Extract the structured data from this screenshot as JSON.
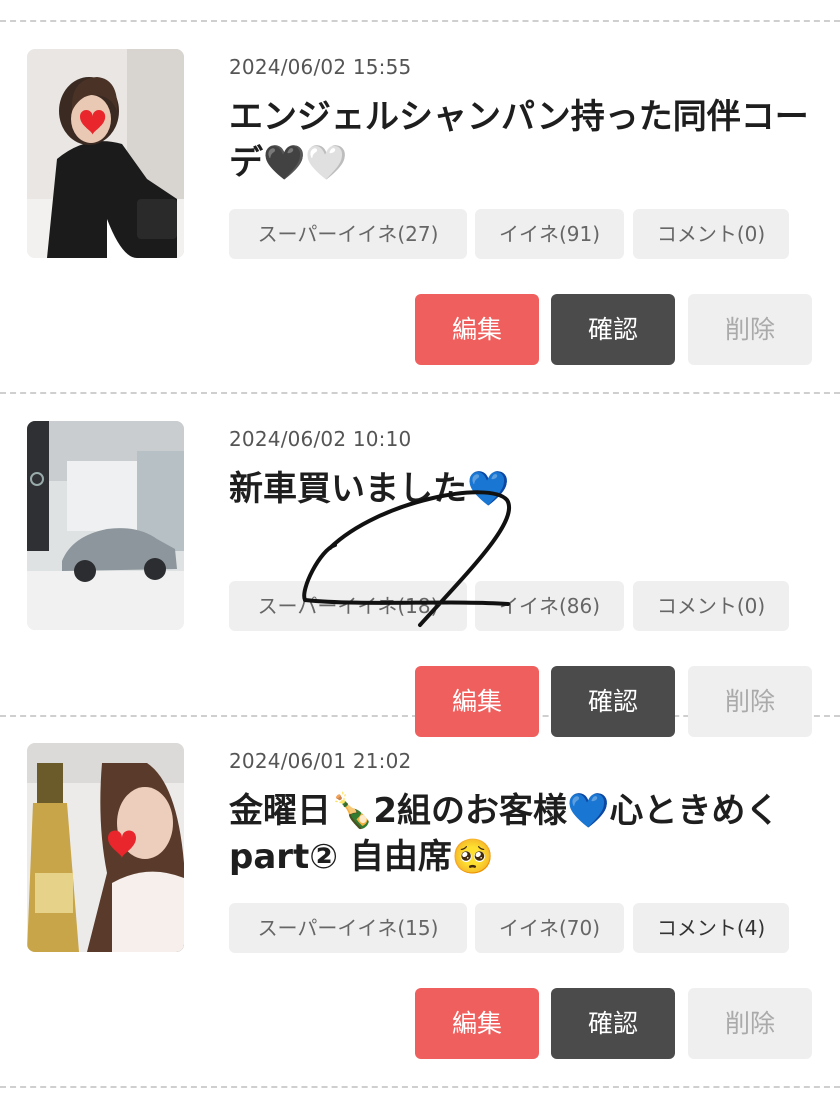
{
  "posts": [
    {
      "date": "2024/06/02 15:55",
      "title": "エンジェルシャンパン持った同伴コーデ🖤🤍",
      "tags": {
        "super_like": "スーパーイイネ(27)",
        "like": "イイネ(91)",
        "comment": "コメント(0)"
      },
      "buttons": {
        "edit": "編集",
        "confirm": "確認",
        "delete": "削除"
      }
    },
    {
      "date": "2024/06/02 10:10",
      "title": "新車買いました💙",
      "tags": {
        "super_like": "スーパーイイネ(18)",
        "like": "イイネ(86)",
        "comment": "コメント(0)"
      },
      "buttons": {
        "edit": "編集",
        "confirm": "確認",
        "delete": "削除"
      }
    },
    {
      "date": "2024/06/01 21:02",
      "title_line1": "金曜日🍾2組のお客様💙心ときめく",
      "title_line2": "part② 自由席🥺",
      "tags": {
        "super_like": "スーパーイイネ(15)",
        "like": "イイネ(70)",
        "comment": "コメント(4)"
      },
      "buttons": {
        "edit": "編集",
        "confirm": "確認",
        "delete": "削除"
      }
    }
  ],
  "colors": {
    "edit": "#ef5f5d",
    "confirm": "#4b4b4b",
    "delete": "#efefef",
    "tag_bg": "#efefef"
  }
}
